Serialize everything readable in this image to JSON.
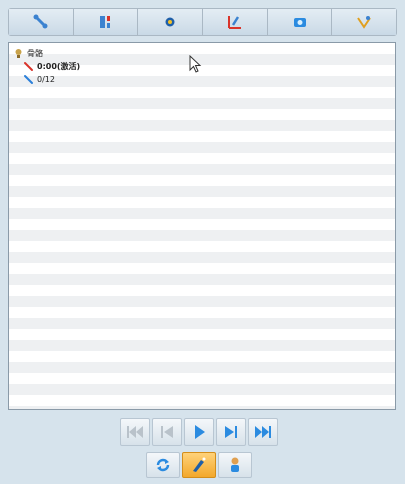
{
  "toolbar": {
    "buttons": [
      {
        "icon": "bone-icon"
      },
      {
        "icon": "layout-icon"
      },
      {
        "icon": "gear-dot-icon"
      },
      {
        "icon": "chart-pen-icon"
      },
      {
        "icon": "camera-icon"
      },
      {
        "icon": "pattern-edit-icon"
      }
    ]
  },
  "tree": {
    "root": {
      "label": "骨骼"
    },
    "children": [
      {
        "label": "0:00(激活)",
        "active": true,
        "color": "#d9342b"
      },
      {
        "label": "0/12",
        "active": false,
        "color": "#2b7fd9"
      }
    ]
  },
  "transport": {
    "buttons": [
      {
        "icon": "first-frame-icon",
        "enabled": false
      },
      {
        "icon": "prev-frame-icon",
        "enabled": false
      },
      {
        "icon": "play-icon",
        "enabled": true
      },
      {
        "icon": "next-frame-icon",
        "enabled": true
      },
      {
        "icon": "last-frame-icon",
        "enabled": true
      }
    ]
  },
  "bottom": {
    "buttons": [
      {
        "icon": "loop-icon",
        "active": false
      },
      {
        "icon": "draw-tool-icon",
        "active": true
      },
      {
        "icon": "character-icon",
        "active": false
      }
    ]
  },
  "colors": {
    "accent": "#2b8be0",
    "active": "#f3a82b"
  }
}
